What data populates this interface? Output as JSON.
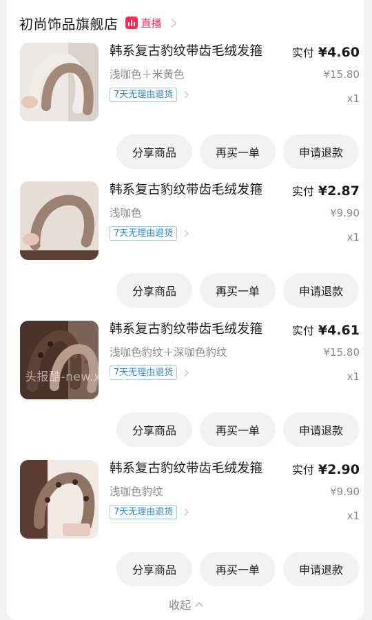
{
  "store": {
    "name": "初尚饰品旗舰店",
    "live_label": "直播"
  },
  "items": [
    {
      "title": "韩系复古豹纹带齿毛绒发箍",
      "variant": "浅咖色＋米黄色",
      "return_policy": "7天无理由退货",
      "paid_label": "实付",
      "paid_amount": "¥4.60",
      "original_price": "¥15.80",
      "quantity": "x1",
      "thumb_colors": [
        "#e4dcd6",
        "#d8cdc3"
      ],
      "buttons": {
        "share": "分享商品",
        "rebuy": "再买一单",
        "refund": "申请退款"
      }
    },
    {
      "title": "韩系复古豹纹带齿毛绒发箍",
      "variant": "浅咖色",
      "return_policy": "7天无理由退货",
      "paid_label": "实付",
      "paid_amount": "¥2.87",
      "original_price": "¥9.90",
      "quantity": "x1",
      "thumb_colors": [
        "#e2d6cf",
        "#a08676"
      ],
      "buttons": {
        "share": "分享商品",
        "rebuy": "再买一单",
        "refund": "申请退款"
      }
    },
    {
      "title": "韩系复古豹纹带齿毛绒发箍",
      "variant": "浅咖色豹纹＋深咖色豹纹",
      "return_policy": "7天无理由退货",
      "paid_label": "实付",
      "paid_amount": "¥4.61",
      "original_price": "¥15.80",
      "quantity": "x1",
      "thumb_colors": [
        "#6e5346",
        "#3a2a22"
      ],
      "buttons": {
        "share": "分享商品",
        "rebuy": "再买一单",
        "refund": "申请退款"
      }
    },
    {
      "title": "韩系复古豹纹带齿毛绒发箍",
      "variant": "浅咖色豹纹",
      "return_policy": "7天无理由退货",
      "paid_label": "实付",
      "paid_amount": "¥2.90",
      "original_price": "¥9.90",
      "quantity": "x1",
      "thumb_colors": [
        "#a98f80",
        "#5b4034"
      ],
      "buttons": {
        "share": "分享商品",
        "rebuy": "再买一单",
        "refund": "申请退款"
      }
    }
  ],
  "collapse_label": "收起",
  "watermark": "头报酷-new.xianbao.fun",
  "colors": {
    "accent_live": "#ff2a55",
    "tag_blue": "#2a88c9",
    "button_bg": "#f2f2f2"
  }
}
